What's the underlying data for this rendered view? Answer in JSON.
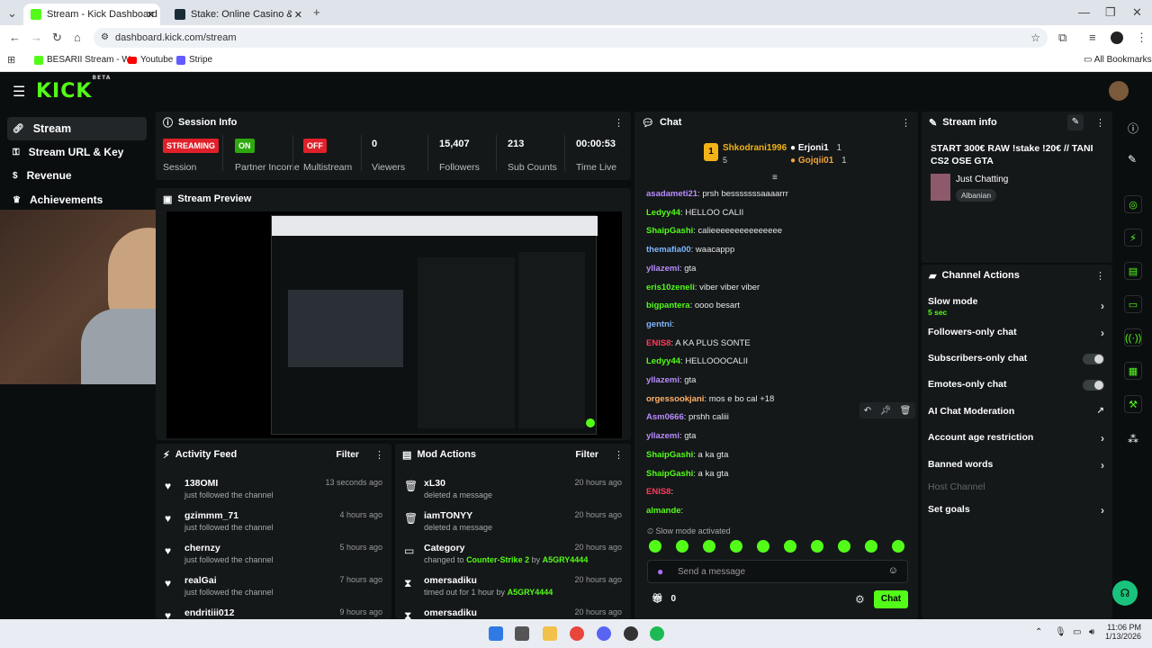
{
  "browser": {
    "tabs": [
      {
        "title": "Stream - Kick Dashboard",
        "active": true
      },
      {
        "title": "Stake: Online Casino & Sports",
        "active": false
      }
    ],
    "url": "dashboard.kick.com/stream",
    "bookmarks": [
      "BESARII Stream - W...",
      "Youtube",
      "Stripe"
    ],
    "all_bookmarks": "All Bookmarks"
  },
  "app": {
    "logo": "KICK",
    "logo_sup": "BETA",
    "brand_color": "#53fc18",
    "sidebar": [
      {
        "label": "Stream",
        "icon": "link-icon"
      },
      {
        "label": "Stream URL & Key",
        "icon": "key-icon"
      },
      {
        "label": "Revenue",
        "icon": "dollar-icon"
      },
      {
        "label": "Achievements",
        "icon": "trophy-icon"
      }
    ]
  },
  "session": {
    "title": "Session Info",
    "stats": [
      {
        "value": "STREAMING",
        "label": "Session",
        "kind": "tag-red"
      },
      {
        "value": "ON",
        "label": "Partner Income",
        "kind": "tag-green"
      },
      {
        "value": "OFF",
        "label": "Multistream",
        "kind": "tag-red"
      },
      {
        "value": "0",
        "label": "Viewers"
      },
      {
        "value": "15,407",
        "label": "Followers"
      },
      {
        "value": "213",
        "label": "Sub Counts"
      },
      {
        "value": "00:00:53",
        "label": "Time Live"
      }
    ]
  },
  "preview": {
    "title": "Stream Preview"
  },
  "activity": {
    "title": "Activity Feed",
    "filter": "Filter",
    "items": [
      {
        "name": "138OMI",
        "sub": "just followed the channel",
        "time": "13 seconds ago"
      },
      {
        "name": "gzimmm_71",
        "sub": "just followed the channel",
        "time": "4 hours ago"
      },
      {
        "name": "chernzy",
        "sub": "just followed the channel",
        "time": "5 hours ago"
      },
      {
        "name": "realGai",
        "sub": "just followed the channel",
        "time": "7 hours ago"
      },
      {
        "name": "endritiii012",
        "sub": "",
        "time": "9 hours ago"
      }
    ]
  },
  "mod": {
    "title": "Mod Actions",
    "filter": "Filter",
    "items": [
      {
        "name": "xL30",
        "sub": "deleted a message",
        "time": "20 hours ago",
        "icon": "trash-icon"
      },
      {
        "name": "iamTONYY",
        "sub": "deleted a message",
        "time": "20 hours ago",
        "icon": "trash-icon"
      },
      {
        "name": "Category",
        "sub_prefix": "changed to",
        "sub_hl": "Counter-Strike 2",
        "sub_mid": "by",
        "sub_user": "A5GRY4444",
        "time": "20 hours ago",
        "icon": "category-icon"
      },
      {
        "name": "omersadiku",
        "sub_prefix": "timed out for 1 hour by",
        "sub_user": "A5GRY4444",
        "time": "20 hours ago",
        "icon": "hourglass-icon"
      },
      {
        "name": "omersadiku",
        "sub": "",
        "time": "20 hours ago",
        "icon": "hourglass-icon"
      }
    ]
  },
  "chat": {
    "title": "Chat",
    "leaders": {
      "first": {
        "name": "Shkodrani1996",
        "count": "5",
        "rank": "1"
      },
      "second": {
        "name": "Erjoni1",
        "count": "1"
      },
      "third": {
        "name": "Gojqii01",
        "count": "1"
      }
    },
    "messages": [
      {
        "user": "asadameti21",
        "color": "#b98cff",
        "text": "prsh besssssssaaaarrr"
      },
      {
        "user": "Ledyy44",
        "color": "#53fc18",
        "text": "HELLOO CALII"
      },
      {
        "user": "ShaipGashi",
        "color": "#53fc18",
        "text": "calieeeeeeeeeeeeeee"
      },
      {
        "user": "themafia00",
        "color": "#7fb6ff",
        "text": "waacappp"
      },
      {
        "user": "yllazemi",
        "color": "#b98cff",
        "text": "gta"
      },
      {
        "user": "eris10zeneli",
        "color": "#53fc18",
        "text": "viber viber viber"
      },
      {
        "user": "bigpantera",
        "color": "#53fc18",
        "text": "oooo besart"
      },
      {
        "user": "gentni",
        "color": "#7fb6ff",
        "text": ""
      },
      {
        "user": "ENIS8",
        "color": "#ff3b5c",
        "text": "A KA PLUS SONTE"
      },
      {
        "user": "Ledyy44",
        "color": "#53fc18",
        "text": "HELLOOOCALII"
      },
      {
        "user": "yllazemi",
        "color": "#b98cff",
        "text": "gta"
      },
      {
        "user": "orgessookjani",
        "color": "#ffb36b",
        "text": "mos e bo cal +18"
      },
      {
        "user": "Asm0666",
        "color": "#b98cff",
        "text": "prshh caliii"
      },
      {
        "user": "yllazemi",
        "color": "#b98cff",
        "text": "gta"
      },
      {
        "user": "ShaipGashi",
        "color": "#53fc18",
        "text": "a ka gta"
      },
      {
        "user": "ShaipGashi",
        "color": "#53fc18",
        "text": "a ka gta"
      },
      {
        "user": "ENIS8",
        "color": "#ff3b5c",
        "text": ""
      },
      {
        "user": "almande",
        "color": "#53fc18",
        "text": ""
      }
    ],
    "slow_mode": "Slow mode activated",
    "input_placeholder": "Send a message",
    "points": "0",
    "send": "Chat"
  },
  "stream_info": {
    "title": "Stream info",
    "stream_title": "START 300€ RAW !stake !20€ // TANI CS2 OSE GTA",
    "category": "Just Chatting",
    "language": "Albanian"
  },
  "channel_actions": {
    "title": "Channel Actions",
    "rows": [
      {
        "label": "Slow mode",
        "sub": "5 sec",
        "control": "chevron"
      },
      {
        "label": "Followers-only chat",
        "control": "chevron"
      },
      {
        "label": "Subscribers-only chat",
        "control": "toggle"
      },
      {
        "label": "Emotes-only chat",
        "control": "toggle"
      },
      {
        "label": "AI Chat Moderation",
        "control": "external"
      },
      {
        "label": "Account age restriction",
        "control": "chevron"
      },
      {
        "label": "Banned words",
        "control": "chevron"
      },
      {
        "label": "Host Channel",
        "control": "none",
        "disabled": true
      },
      {
        "label": "Set goals",
        "control": "chevron"
      }
    ]
  },
  "taskbar": {
    "time": "11:06 PM",
    "date": "1/13/2026"
  }
}
